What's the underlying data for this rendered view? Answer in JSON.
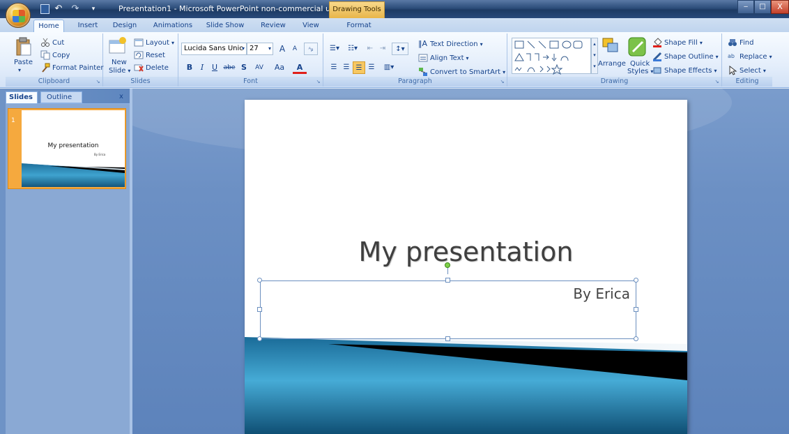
{
  "window": {
    "title": "Presentation1 - Microsoft PowerPoint non-commercial use",
    "context_tab_group": "Drawing Tools",
    "minimize": "‒",
    "maximize": "□",
    "close": "X"
  },
  "quick_access": {
    "undo": "↶",
    "redo": "↷",
    "more": "▾"
  },
  "tabs": [
    {
      "label": "Home"
    },
    {
      "label": "Insert"
    },
    {
      "label": "Design"
    },
    {
      "label": "Animations"
    },
    {
      "label": "Slide Show"
    },
    {
      "label": "Review"
    },
    {
      "label": "View"
    },
    {
      "label": "Format"
    }
  ],
  "ribbon": {
    "clipboard": {
      "label": "Clipboard",
      "paste": "Paste",
      "cut": "Cut",
      "copy": "Copy",
      "format_painter": "Format Painter"
    },
    "slides": {
      "label": "Slides",
      "new_slide": "New",
      "new_slide_2": "Slide",
      "layout": "Layout",
      "reset": "Reset",
      "delete": "Delete"
    },
    "font": {
      "label": "Font",
      "font_name": "Lucida Sans Unic",
      "font_size": "27",
      "grow": "A",
      "shrink": "A",
      "clear": "ᴬᵦ",
      "bold": "B",
      "italic": "I",
      "underline": "U",
      "strike": "abe",
      "shadow": "S",
      "spacing": "AV",
      "change_case": "Aa",
      "font_color": "A"
    },
    "paragraph": {
      "label": "Paragraph",
      "text_direction": "Text Direction",
      "align_text": "Align Text",
      "convert_smartart": "Convert to SmartArt"
    },
    "drawing": {
      "label": "Drawing",
      "arrange": "Arrange",
      "quick_styles": "Quick",
      "quick_styles_2": "Styles",
      "shape_fill": "Shape Fill",
      "shape_outline": "Shape Outline",
      "shape_effects": "Shape Effects"
    },
    "editing": {
      "label": "Editing",
      "find": "Find",
      "replace": "Replace",
      "select": "Select"
    }
  },
  "left_pane": {
    "tab_slides": "Slides",
    "tab_outline": "Outline",
    "close": "x",
    "slide_number": "1",
    "thumb_title": "My presentation",
    "thumb_subtitle": "By Erica"
  },
  "slide": {
    "title": "My presentation",
    "subtitle": "By Erica"
  },
  "colors": {
    "ribbon_bg": "#e4eefb",
    "title_bar": "#2c4d7a",
    "workspace": "#6c90c4",
    "selection_orange": "#f5a93e",
    "band_teal": "#2a8ab8"
  }
}
